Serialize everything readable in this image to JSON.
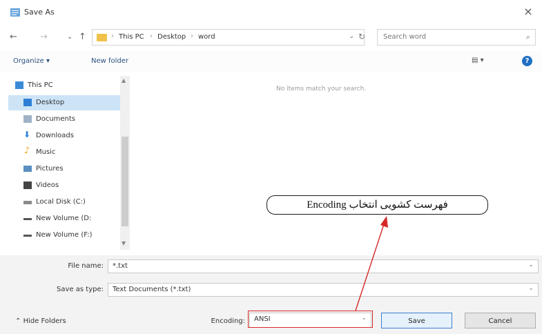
{
  "window": {
    "title": "Save As",
    "close_glyph": "×"
  },
  "nav": {
    "back_glyph": "←",
    "forward_glyph": "→",
    "up_glyph": "↑",
    "recent_glyph": "⌄",
    "path": [
      "This PC",
      "Desktop",
      "word"
    ],
    "path_sep": "›",
    "refresh_glyph": "↻",
    "search_placeholder": "Search word",
    "search_glyph": "⌕"
  },
  "toolbar": {
    "organize_label": "Organize ▾",
    "new_folder_label": "New folder",
    "view_label": "▤ ▾",
    "help_glyph": "?"
  },
  "sidebar": {
    "items": [
      {
        "label": "This PC",
        "icon": "computer-icon",
        "color": "#3b8ad8"
      },
      {
        "label": "Desktop",
        "icon": "desktop-icon",
        "color": "#2d7fd6"
      },
      {
        "label": "Documents",
        "icon": "documents-icon",
        "color": "#9fb3c8"
      },
      {
        "label": "Downloads",
        "icon": "downloads-icon",
        "color": "#2d7fd6"
      },
      {
        "label": "Music",
        "icon": "music-icon",
        "color": "#f2a51a"
      },
      {
        "label": "Pictures",
        "icon": "pictures-icon",
        "color": "#5a8fc0"
      },
      {
        "label": "Videos",
        "icon": "videos-icon",
        "color": "#444444"
      },
      {
        "label": "Local Disk (C:)",
        "icon": "drive-icon",
        "color": "#8a8a8a"
      },
      {
        "label": "New Volume (D:",
        "icon": "drive-icon",
        "color": "#555555"
      },
      {
        "label": "New Volume (F:)",
        "icon": "drive-icon",
        "color": "#555555"
      }
    ],
    "selected_index": 1
  },
  "content": {
    "empty_message": "No items match your search."
  },
  "form": {
    "file_name_label": "File name:",
    "file_name_value": "*.txt",
    "save_type_label": "Save as type:",
    "save_type_value": "Text Documents (*.txt)",
    "encoding_label": "Encoding:",
    "encoding_value": "ANSI",
    "hide_folders_label": "Hide Folders",
    "save_label": "Save",
    "cancel_label": "Cancel"
  },
  "annotation": {
    "text": "فهرست کشویی انتخاب Encoding",
    "color": "#d62828"
  }
}
